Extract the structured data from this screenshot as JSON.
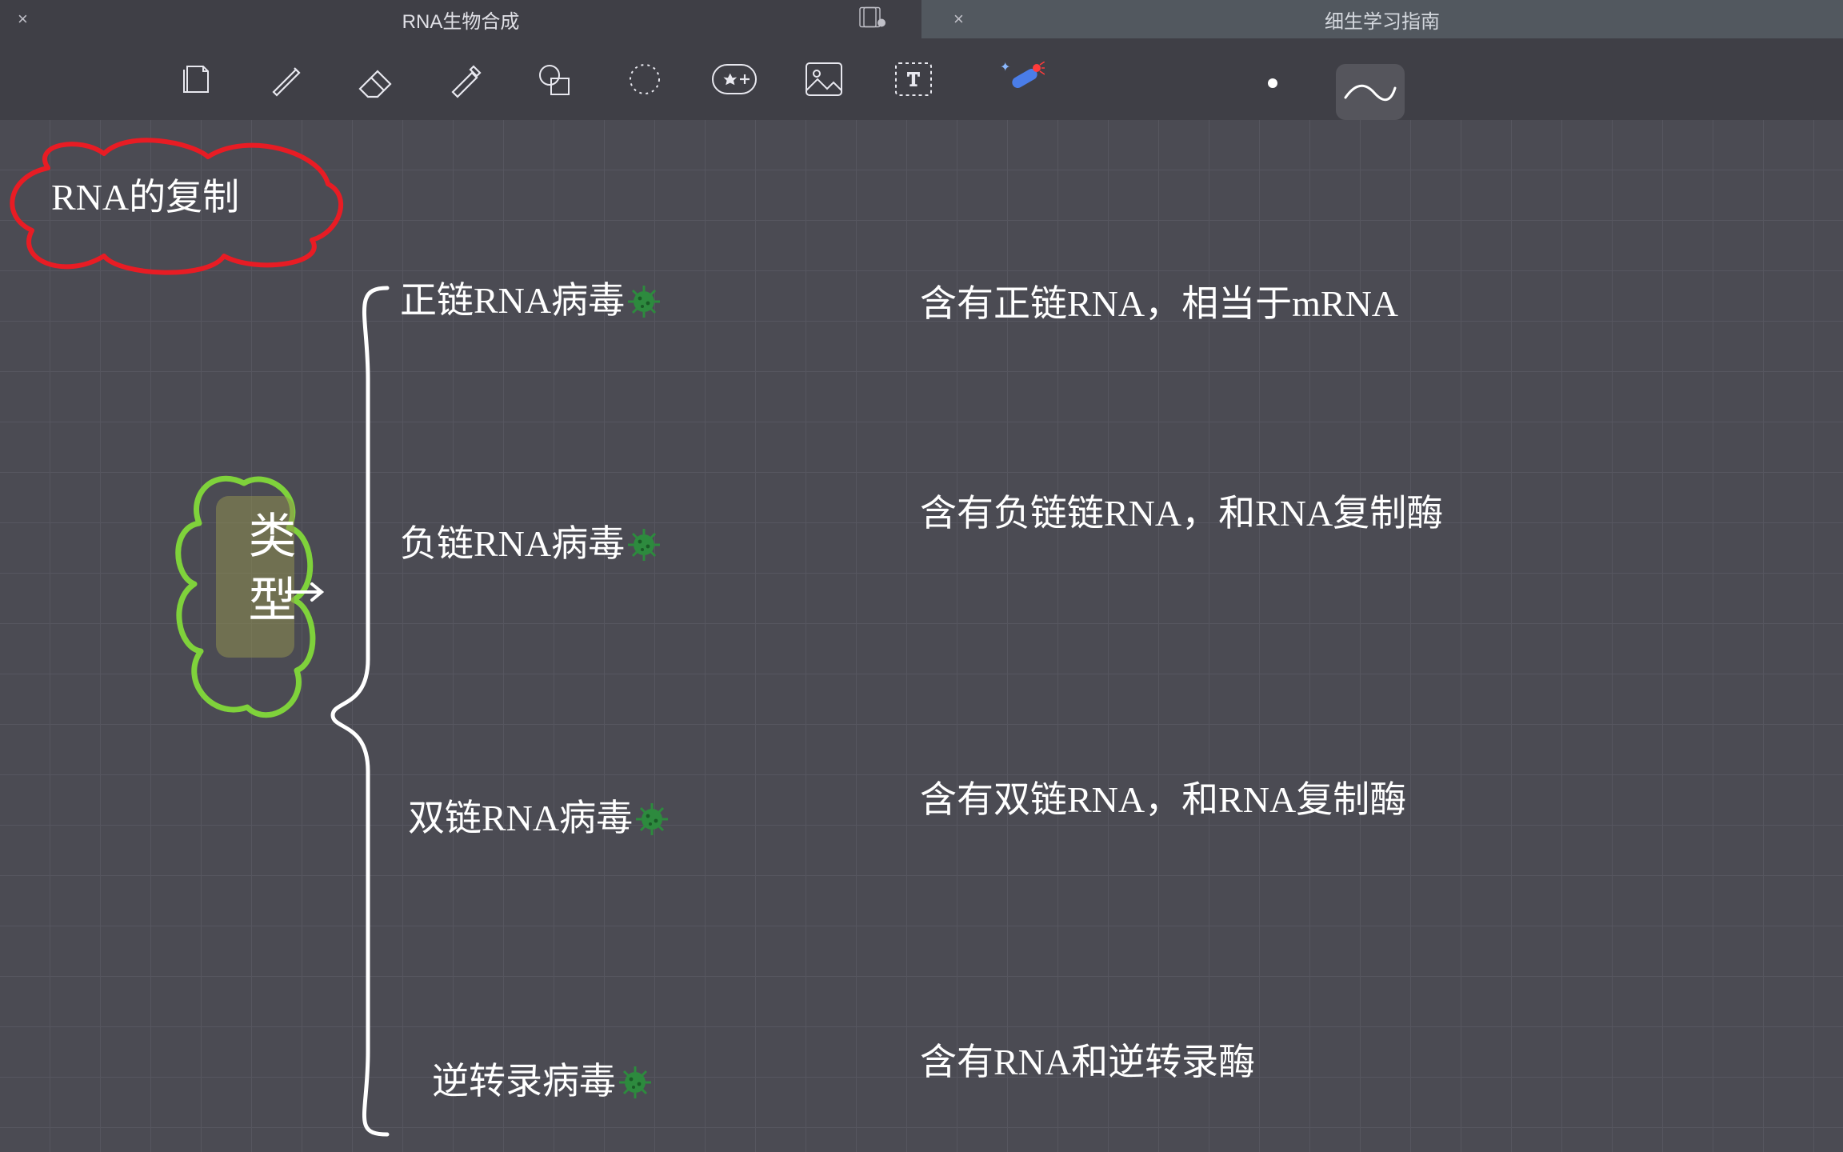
{
  "tabs": {
    "active": {
      "title": "RNA生物合成"
    },
    "inactive": {
      "title": "细生学习指南"
    }
  },
  "canvas": {
    "title": "RNA的复制",
    "types_label": "类型",
    "rows": [
      {
        "name": "正链RNA病毒",
        "desc": "含有正链RNA，相当于mRNA"
      },
      {
        "name": "负链RNA病毒",
        "desc": "含有负链链RNA，和RNA复制酶"
      },
      {
        "name": "双链RNA病毒",
        "desc": "含有双链RNA，和RNA复制酶"
      },
      {
        "name": "逆转录病毒",
        "desc": "含有RNA和逆转录酶"
      }
    ]
  }
}
